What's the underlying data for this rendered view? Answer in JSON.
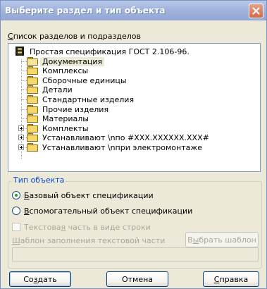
{
  "window": {
    "title": "Выберите раздел и тип объекта",
    "close_icon": "close-icon",
    "colors": {
      "titlebar": "#a4b6de",
      "close": "#d06a4c",
      "dialog_bg": "#ece9d8"
    }
  },
  "sections": {
    "label_prefix": "",
    "label_accel": "С",
    "label_rest": "писок разделов и подразделов",
    "tree": [
      {
        "label": "Простая спецификация ГОСТ 2.106-96.",
        "icon": "book-icon",
        "level": 0
      },
      {
        "label": "Документация",
        "icon": "folder-open-icon",
        "level": 1,
        "selected": true
      },
      {
        "label": "Комплексы",
        "icon": "folder-icon",
        "level": 1
      },
      {
        "label": "Сборочные единицы",
        "icon": "folder-icon",
        "level": 1
      },
      {
        "label": "Детали",
        "icon": "folder-icon",
        "level": 1
      },
      {
        "label": "Стандартные изделия",
        "icon": "folder-icon",
        "level": 1
      },
      {
        "label": "Прочие изделия",
        "icon": "folder-icon",
        "level": 1
      },
      {
        "label": "Материалы",
        "icon": "folder-icon",
        "level": 1
      },
      {
        "label": "Комплекты",
        "icon": "folder-icon",
        "level": 1,
        "expander": true
      },
      {
        "label": "Устанавливают \\nпо #XXX.XXXXXX.XXX#",
        "icon": "folder-icon",
        "level": 1,
        "expander": true
      },
      {
        "label": "Устанавливают \\nпри электромонтаже",
        "icon": "folder-icon",
        "level": 1,
        "expander": true
      }
    ]
  },
  "object_type": {
    "group_title": "Тип объекта",
    "base_accel": "Б",
    "base_rest": "азовый объект спецификации",
    "base_checked": true,
    "aux_accel": "В",
    "aux_rest": "спомогательный объект спецификации",
    "aux_checked": false,
    "text_part_pre": "Текстова",
    "text_part_accel": "я",
    "text_part_post": " часть в виде строки",
    "text_part_checked": false,
    "template_label_accel": "Ш",
    "template_label_rest": "аблон заполнения текстовой части",
    "template_value": "",
    "choose_template_pre": "В",
    "choose_template_accel": "ы",
    "choose_template_post": "брать шаблон"
  },
  "buttons": {
    "create_pre": "Со",
    "create_accel": "з",
    "create_post": "дать",
    "cancel": "Отмена",
    "help_accel": "С",
    "help_rest": "правка"
  }
}
